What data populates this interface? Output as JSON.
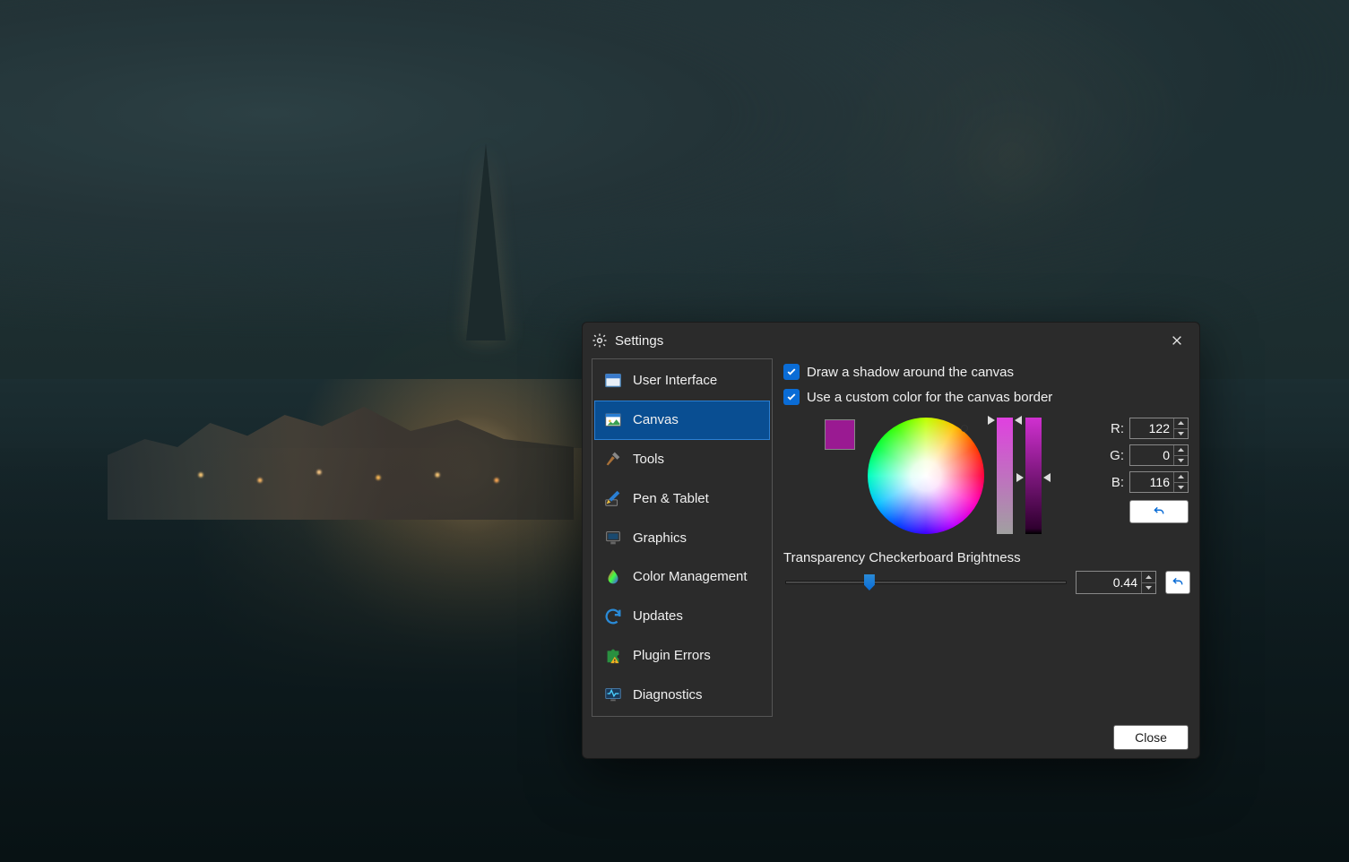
{
  "dialog": {
    "title": "Settings",
    "close_button": "Close"
  },
  "sidebar": {
    "items": [
      {
        "label": "User Interface",
        "icon": "window-icon"
      },
      {
        "label": "Canvas",
        "icon": "image-icon",
        "selected": true
      },
      {
        "label": "Tools",
        "icon": "hammer-icon"
      },
      {
        "label": "Pen & Tablet",
        "icon": "pen-icon"
      },
      {
        "label": "Graphics",
        "icon": "monitor-icon"
      },
      {
        "label": "Color Management",
        "icon": "color-drop-icon"
      },
      {
        "label": "Updates",
        "icon": "refresh-icon"
      },
      {
        "label": "Plugin Errors",
        "icon": "puzzle-warning-icon"
      },
      {
        "label": "Diagnostics",
        "icon": "diagnostics-icon"
      }
    ]
  },
  "canvas": {
    "shadow_checkbox": {
      "label": "Draw a shadow around the canvas",
      "checked": true
    },
    "border_checkbox": {
      "label": "Use a custom color for the canvas border",
      "checked": true
    },
    "color": {
      "swatch": "#9a1a92",
      "r_label": "R:",
      "g_label": "G:",
      "b_label": "B:",
      "r": "122",
      "g": "0",
      "b": "116"
    },
    "brightness": {
      "label": "Transparency Checkerboard Brightness",
      "value": "0.44",
      "slider_percent": 28
    }
  }
}
